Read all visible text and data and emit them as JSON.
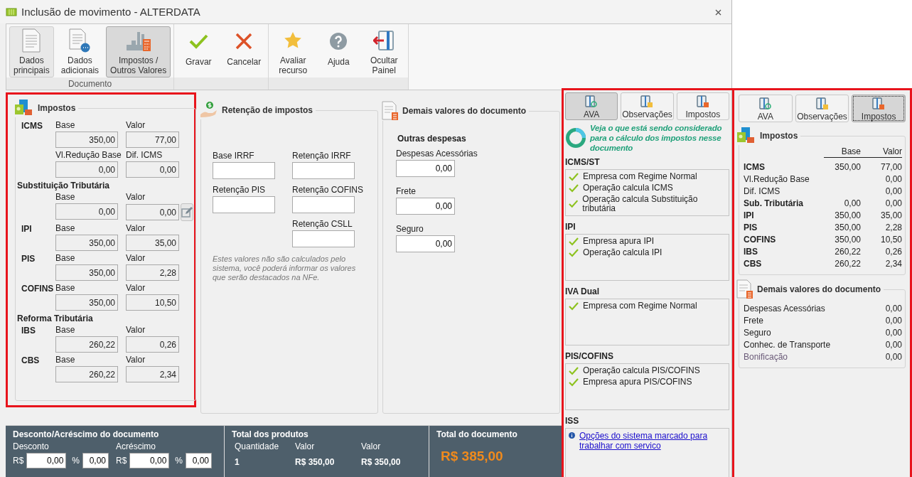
{
  "window": {
    "title": "Inclusão de movimento - ALTERDATA"
  },
  "ribbon": {
    "groups": [
      {
        "label": "Documento",
        "buttons": [
          {
            "lines": [
              "Dados",
              "principais"
            ],
            "selected": false,
            "hovered": true
          },
          {
            "lines": [
              "Dados",
              "adicionais"
            ],
            "selected": false,
            "hovered": false
          },
          {
            "lines": [
              "Impostos /",
              "Outros Valores"
            ],
            "selected": true,
            "hovered": false
          }
        ]
      },
      {
        "buttons": [
          {
            "lines": [
              "Gravar"
            ],
            "selected": false,
            "hovered": false
          },
          {
            "lines": [
              "Cancelar"
            ],
            "selected": false,
            "hovered": false
          }
        ]
      },
      {
        "buttons": [
          {
            "lines": [
              "Avaliar",
              "recurso"
            ],
            "selected": false,
            "hovered": false
          },
          {
            "lines": [
              "Ajuda"
            ],
            "selected": false,
            "hovered": false
          },
          {
            "lines": [
              "Ocultar",
              "Painel"
            ],
            "selected": false,
            "hovered": false
          }
        ]
      }
    ]
  },
  "impostos": {
    "title": "Impostos",
    "groups": [
      {
        "kind": "fields",
        "label": "ICMS",
        "fields": [
          {
            "label": "Base",
            "value": "350,00"
          },
          {
            "label": "Valor",
            "value": "77,00"
          }
        ]
      },
      {
        "kind": "fields",
        "fields": [
          {
            "label": "Vl.Redução Base",
            "value": "0,00"
          },
          {
            "label": "Dif. ICMS",
            "value": "0,00"
          }
        ]
      },
      {
        "kind": "heading",
        "label": "Substituição Tributária"
      },
      {
        "kind": "fields",
        "fields": [
          {
            "label": "Base",
            "value": "0,00"
          },
          {
            "label": "Valor",
            "value": "0,00",
            "edit_button": true
          }
        ]
      },
      {
        "kind": "fields",
        "label": "IPI",
        "fields": [
          {
            "label": "Base",
            "value": "350,00"
          },
          {
            "label": "Valor",
            "value": "35,00"
          }
        ]
      },
      {
        "kind": "fields",
        "label": "PIS",
        "fields": [
          {
            "label": "Base",
            "value": "350,00"
          },
          {
            "label": "Valor",
            "value": "2,28"
          }
        ]
      },
      {
        "kind": "fields",
        "label": "COFINS",
        "fields": [
          {
            "label": "Base",
            "value": "350,00"
          },
          {
            "label": "Valor",
            "value": "10,50"
          }
        ]
      },
      {
        "kind": "heading",
        "label": "Reforma Tributária"
      },
      {
        "kind": "fields",
        "label": "IBS",
        "fields": [
          {
            "label": "Base",
            "value": "260,22"
          },
          {
            "label": "Valor",
            "value": "0,26"
          }
        ]
      },
      {
        "kind": "fields",
        "label": "CBS",
        "fields": [
          {
            "label": "Base",
            "value": "260,22"
          },
          {
            "label": "Valor",
            "value": "2,34"
          }
        ]
      }
    ]
  },
  "retencao": {
    "title": "Retenção de impostos",
    "fields": [
      {
        "label": "Base IRRF"
      },
      {
        "label": "Retenção IRRF"
      },
      {
        "label": "Retenção PIS"
      },
      {
        "label": "Retenção COFINS"
      },
      {
        "label": "Retenção CSLL"
      }
    ],
    "note": "Estes valores não são calculados pelo sistema, você poderá informar os valores que serão destacados na NFe."
  },
  "demais": {
    "title": "Demais valores do documento",
    "section": "Outras despesas",
    "fields": [
      {
        "label": "Despesas Acessórias",
        "value": "0,00"
      },
      {
        "label": "Frete",
        "value": "0,00"
      },
      {
        "label": "Seguro",
        "value": "0,00"
      }
    ]
  },
  "bottom": {
    "discount": {
      "title": "Desconto/Acréscimo do documento",
      "parts": [
        {
          "label": "Desconto",
          "currency": "R$",
          "value": "0,00",
          "percent_sign": "%",
          "percent": "0,00"
        },
        {
          "label": "Acréscimo",
          "currency": "R$",
          "value": "0,00",
          "percent_sign": "%",
          "percent": "0,00"
        }
      ]
    },
    "products": {
      "title": "Total dos produtos",
      "columns": [
        "Quantidade",
        "Valor",
        "Valor"
      ],
      "values": [
        "1",
        "R$ 350,00",
        "R$ 350,00"
      ]
    },
    "total": {
      "title": "Total do documento",
      "value": "R$ 385,00"
    }
  },
  "ava": {
    "tabs": [
      {
        "label": "AVA",
        "selected": true
      },
      {
        "label": "Observações",
        "selected": false
      },
      {
        "label": "Impostos",
        "selected": false
      }
    ],
    "headline": "Veja o que está sendo considerado para o cálculo dos impostos nesse documento",
    "sections": [
      {
        "kind": "checks",
        "title": "ICMS/ST",
        "items": [
          {
            "text": "Empresa com Regime Normal",
            "checked": true
          },
          {
            "text": "Operação calcula ICMS",
            "checked": true
          },
          {
            "text": "Operação calcula Substituição tributária",
            "checked": true
          }
        ]
      },
      {
        "kind": "checks",
        "title": "IPI",
        "items": [
          {
            "text": "Empresa apura IPI",
            "checked": true
          },
          {
            "text": "Operação calcula IPI",
            "checked": true
          }
        ]
      },
      {
        "kind": "checks",
        "title": "IVA Dual",
        "items": [
          {
            "text": "Empresa com Regime Normal",
            "checked": true
          }
        ]
      },
      {
        "kind": "checks",
        "title": "PIS/COFINS",
        "items": [
          {
            "text": "Operação calcula PIS/COFINS",
            "checked": true
          },
          {
            "text": "Empresa apura PIS/COFINS",
            "checked": true
          }
        ]
      },
      {
        "kind": "info",
        "title": "ISS",
        "link": "Opções do sistema marcado para trabalhar com servico"
      }
    ]
  },
  "summary": {
    "tabs": [
      {
        "label": "AVA",
        "selected": false
      },
      {
        "label": "Observações",
        "selected": false
      },
      {
        "label": "Impostos",
        "selected": true
      }
    ],
    "impostos": {
      "title": "Impostos",
      "columns": [
        "Base",
        "Valor"
      ],
      "rows": [
        {
          "label": "ICMS",
          "bold": true,
          "base": "350,00",
          "valor": "77,00"
        },
        {
          "label": "Vl.Redução Base",
          "bold": false,
          "valor": "0,00"
        },
        {
          "label": "Dif. ICMS",
          "bold": false,
          "valor": "0,00"
        },
        {
          "label": "Sub. Tributária",
          "bold": true,
          "base": "0,00",
          "valor": "0,00"
        },
        {
          "label": "IPI",
          "bold": true,
          "base": "350,00",
          "valor": "35,00"
        },
        {
          "label": "PIS",
          "bold": true,
          "base": "350,00",
          "valor": "2,28"
        },
        {
          "label": "COFINS",
          "bold": true,
          "base": "350,00",
          "valor": "10,50"
        },
        {
          "label": "IBS",
          "bold": true,
          "base": "260,22",
          "valor": "0,26"
        },
        {
          "label": "CBS",
          "bold": true,
          "base": "260,22",
          "valor": "2,34"
        }
      ]
    },
    "demais": {
      "title": "Demais valores do documento",
      "rows": [
        {
          "label": "Despesas Acessórias",
          "value": "0,00",
          "muted": false
        },
        {
          "label": "Frete",
          "value": "0,00",
          "muted": false
        },
        {
          "label": "Seguro",
          "value": "0,00",
          "muted": false
        },
        {
          "label": "Conhec. de Transporte",
          "value": "0,00",
          "muted": false
        },
        {
          "label": "Bonificação",
          "value": "0,00",
          "muted": true
        }
      ]
    }
  }
}
